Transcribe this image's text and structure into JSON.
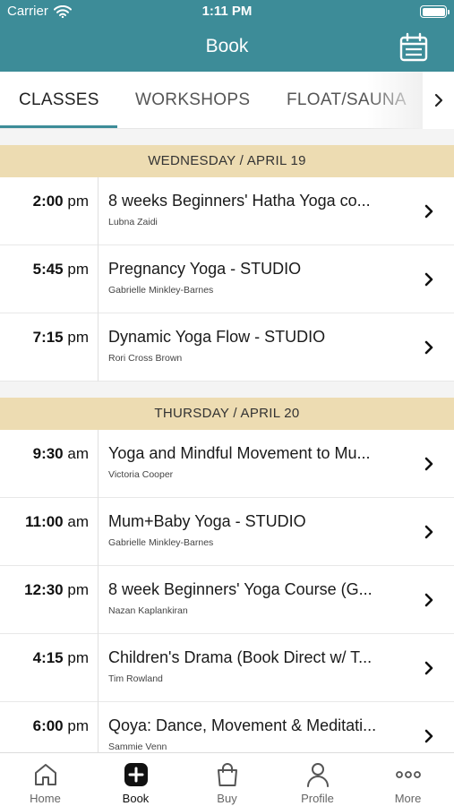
{
  "status_bar": {
    "carrier": "Carrier",
    "time": "1:11 PM"
  },
  "header": {
    "title": "Book",
    "calendar_icon": "calendar-icon"
  },
  "tabs": [
    {
      "label": "CLASSES",
      "active": true
    },
    {
      "label": "WORKSHOPS",
      "active": false
    },
    {
      "label": "FLOAT/SAUNA",
      "active": false
    }
  ],
  "days": [
    {
      "label": "WEDNESDAY / APRIL 19",
      "classes": [
        {
          "time": "2:00",
          "period": "pm",
          "name": "8 weeks Beginners' Hatha Yoga co...",
          "teacher": "Lubna Zaidi"
        },
        {
          "time": "5:45",
          "period": "pm",
          "name": "Pregnancy Yoga - STUDIO",
          "teacher": "Gabrielle Minkley-Barnes"
        },
        {
          "time": "7:15",
          "period": "pm",
          "name": "Dynamic Yoga Flow - STUDIO",
          "teacher": "Rori Cross Brown"
        }
      ]
    },
    {
      "label": "THURSDAY / APRIL 20",
      "classes": [
        {
          "time": "9:30",
          "period": "am",
          "name": "Yoga and Mindful Movement to Mu...",
          "teacher": "Victoria Cooper"
        },
        {
          "time": "11:00",
          "period": "am",
          "name": "Mum+Baby Yoga - STUDIO",
          "teacher": "Gabrielle Minkley-Barnes"
        },
        {
          "time": "12:30",
          "period": "pm",
          "name": "8 week Beginners' Yoga Course (G...",
          "teacher": "Nazan Kaplankiran"
        },
        {
          "time": "4:15",
          "period": "pm",
          "name": "Children's Drama (Book Direct w/ T...",
          "teacher": "Tim Rowland"
        },
        {
          "time": "6:00",
          "period": "pm",
          "name": "Qoya: Dance, Movement & Meditati...",
          "teacher": "Sammie Venn"
        }
      ]
    }
  ],
  "tab_bar": [
    {
      "label": "Home",
      "icon": "home-icon"
    },
    {
      "label": "Book",
      "icon": "plus-square-icon",
      "active": true
    },
    {
      "label": "Buy",
      "icon": "shopping-bag-icon"
    },
    {
      "label": "Profile",
      "icon": "person-icon"
    },
    {
      "label": "More",
      "icon": "ellipsis-icon"
    }
  ],
  "colors": {
    "header": "#3d8c98",
    "day_header": "#eddcb2",
    "accent": "#3d8c98"
  }
}
